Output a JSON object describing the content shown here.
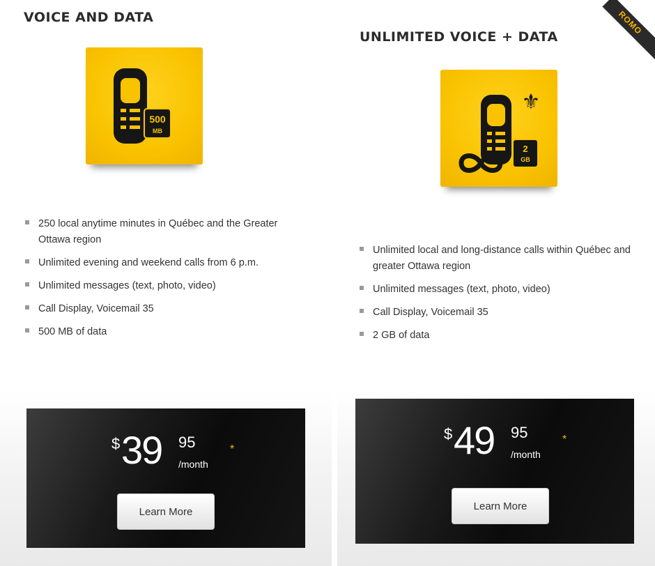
{
  "plans": [
    {
      "title": "VOICE AND DATA",
      "icon": "phone-500mb-icon",
      "icon_badge_top": "500",
      "icon_badge_bottom": "MB",
      "features": [
        "250 local anytime minutes in Québec and the Greater Ottawa region",
        "Unlimited evening and weekend calls from 6 p.m.",
        "Unlimited messages (text, photo, video)",
        "Call Display, Voicemail 35",
        "500 MB of data"
      ],
      "price": {
        "currency": "$",
        "amount": "39",
        "cents": "95",
        "period": "/month",
        "asterisk": "*"
      },
      "button": "Learn More"
    },
    {
      "title": "UNLIMITED VOICE + DATA",
      "icon": "phone-unlimited-2gb-icon",
      "icon_badge_top": "2",
      "icon_badge_bottom": "GB",
      "features": [
        "Unlimited local and long-distance calls within Québec and greater Ottawa region",
        "Unlimited messages (text, photo, video)",
        "Call Display, Voicemail 35",
        "2 GB of data"
      ],
      "price": {
        "currency": "$",
        "amount": "49",
        "cents": "95",
        "period": "/month",
        "asterisk": "*"
      },
      "button": "Learn More"
    }
  ],
  "promo_ribbon": "ROMO",
  "colors": {
    "accent": "#f9c300",
    "dark": "#111111",
    "bullet": "#9a9a9a"
  }
}
